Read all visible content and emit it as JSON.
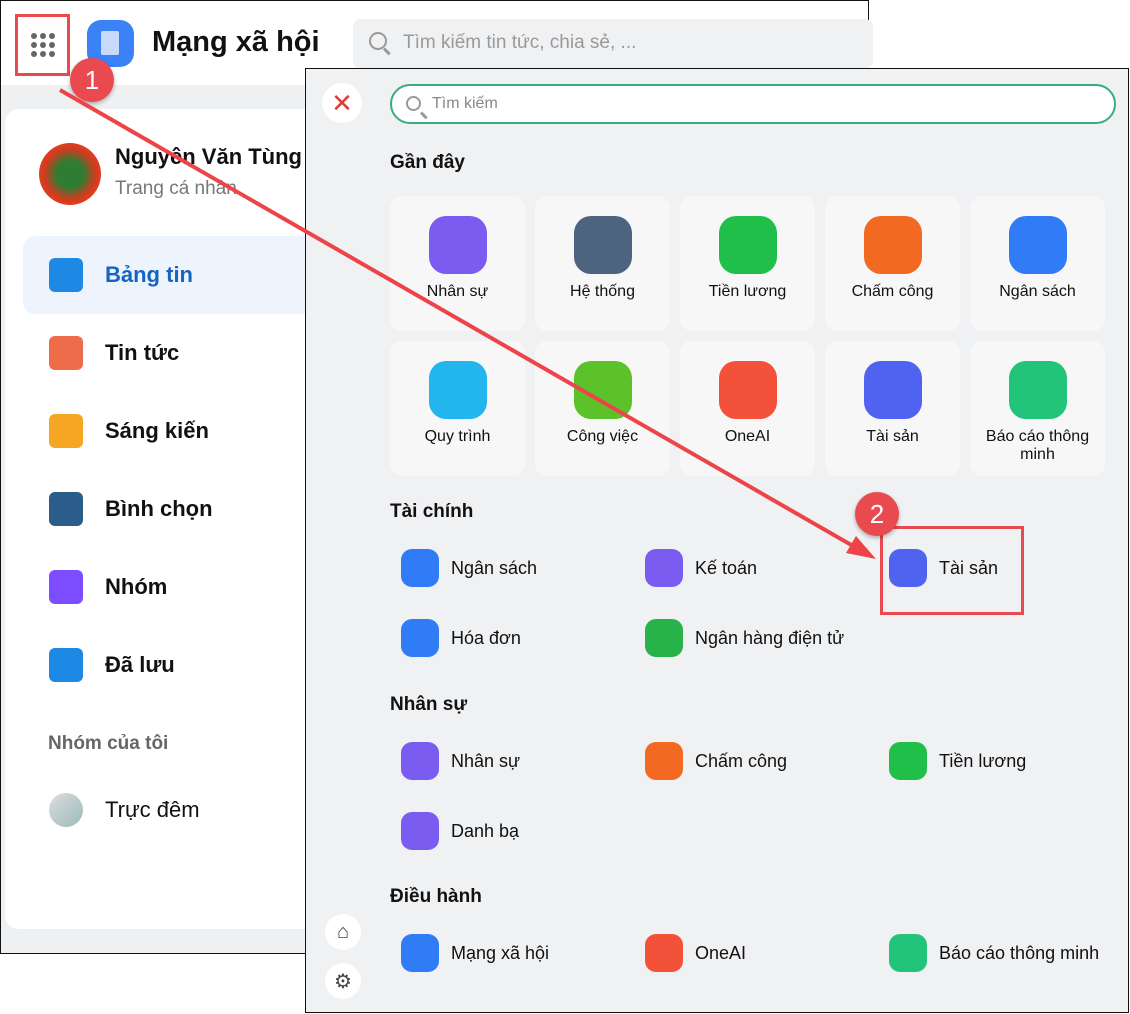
{
  "app": {
    "title": "Mạng xã hội",
    "search_placeholder": "Tìm kiếm tin tức, chia sẻ, ...",
    "user": {
      "name": "Nguyên Văn Tùng",
      "subtitle": "Trang cá nhân"
    },
    "nav": [
      {
        "label": "Bảng tin",
        "color": "#1e88e5"
      },
      {
        "label": "Tin tức",
        "color": "#ef6c4a"
      },
      {
        "label": "Sáng kiến",
        "color": "#f5a623"
      },
      {
        "label": "Bình chọn",
        "color": "#2c5d8a"
      },
      {
        "label": "Nhóm",
        "color": "#7c4dff"
      },
      {
        "label": "Đã lưu",
        "color": "#1e88e5"
      }
    ],
    "groups_header": "Nhóm của tôi",
    "group": "Trực đêm"
  },
  "badges": {
    "one": "1",
    "two": "2"
  },
  "panel": {
    "search_placeholder": "Tìm kiếm",
    "close": "✕",
    "recent_title": "Gần đây",
    "recent": [
      {
        "label": "Nhân sự",
        "color": "#7b5cf0"
      },
      {
        "label": "Hệ thống",
        "color": "#4d6480"
      },
      {
        "label": "Tiền lương",
        "color": "#1fbf4a"
      },
      {
        "label": "Chấm công",
        "color": "#f26a21"
      },
      {
        "label": "Ngân sách",
        "color": "#2f7cf6"
      },
      {
        "label": "Quy trình",
        "color": "#22b5ee"
      },
      {
        "label": "Công việc",
        "color": "#5cc22a"
      },
      {
        "label": "OneAI",
        "color": "#f4513a"
      },
      {
        "label": "Tài sản",
        "color": "#4f63f0"
      },
      {
        "label": "Báo cáo thông minh",
        "color": "#22c47a"
      }
    ],
    "sections": [
      {
        "title": "Tài chính",
        "items": [
          {
            "label": "Ngân sách",
            "color": "#2f7cf6"
          },
          {
            "label": "Kế toán",
            "color": "#7b5cf0"
          },
          {
            "label": "Tài sản",
            "color": "#4f63f0"
          },
          {
            "label": "Hóa đơn",
            "color": "#2f7cf6"
          },
          {
            "label": "Ngân hàng điện tử",
            "color": "#27b24a"
          }
        ]
      },
      {
        "title": "Nhân sự",
        "items": [
          {
            "label": "Nhân sự",
            "color": "#7b5cf0"
          },
          {
            "label": "Chấm công",
            "color": "#f26a21"
          },
          {
            "label": "Tiền lương",
            "color": "#1fbf4a"
          },
          {
            "label": "Danh bạ",
            "color": "#7b5cf0"
          }
        ]
      },
      {
        "title": "Điều hành",
        "items": [
          {
            "label": "Mạng xã hội",
            "color": "#2f7cf6"
          },
          {
            "label": "OneAI",
            "color": "#f4513a"
          },
          {
            "label": "Báo cáo thông minh",
            "color": "#22c47a"
          }
        ]
      }
    ]
  }
}
